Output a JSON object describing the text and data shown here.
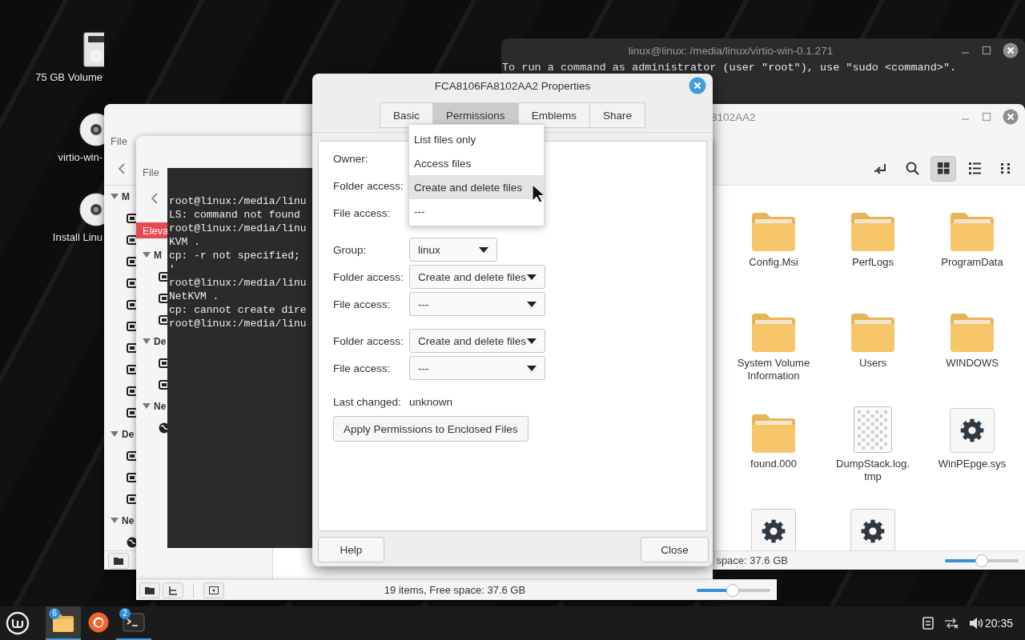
{
  "desktop_icons": [
    {
      "label": "75 GB Volume",
      "kind": "drive"
    },
    {
      "label": "virtio-win-",
      "kind": "disc"
    },
    {
      "label": "Install Linu",
      "kind": "disc"
    }
  ],
  "terminal_back": {
    "title": "linux@linux: /media/linux/virtio-win-0.1.271",
    "lines": [
      "To run a command as administrator (user \"root\"), use \"sudo <command>\"."
    ]
  },
  "file_manager_back": {
    "title": "8102AA2",
    "menu_label": "File",
    "sidebar": [
      {
        "kind": "header",
        "label": "M"
      },
      {
        "kind": "place"
      },
      {
        "kind": "place"
      },
      {
        "kind": "place"
      },
      {
        "kind": "place"
      },
      {
        "kind": "place"
      },
      {
        "kind": "place"
      },
      {
        "kind": "place"
      },
      {
        "kind": "place"
      },
      {
        "kind": "place"
      },
      {
        "kind": "place"
      },
      {
        "kind": "header",
        "label": "De"
      },
      {
        "kind": "place"
      },
      {
        "kind": "place"
      },
      {
        "kind": "place"
      },
      {
        "kind": "header",
        "label": "Ne"
      },
      {
        "kind": "network"
      }
    ],
    "view_buttons": [
      {
        "kind": "return",
        "selected": false
      },
      {
        "kind": "search",
        "selected": false
      },
      {
        "kind": "grid",
        "selected": true
      },
      {
        "kind": "list",
        "selected": false
      },
      {
        "kind": "compact",
        "selected": false
      }
    ],
    "items": [
      {
        "name": "Config.Msi",
        "kind": "folder"
      },
      {
        "name": "PerfLogs",
        "kind": "folder"
      },
      {
        "name": "ProgramData",
        "kind": "folder"
      },
      {
        "name": "System Volume Information",
        "kind": "folder"
      },
      {
        "name": "Users",
        "kind": "folder"
      },
      {
        "name": "WINDOWS",
        "kind": "folder"
      },
      {
        "name": "found.000",
        "kind": "folder"
      },
      {
        "name": "DumpStack.log.tmp",
        "kind": "text"
      },
      {
        "name": "WinPEpge.sys",
        "kind": "system"
      },
      {
        "kind": "system"
      },
      {
        "kind": "system"
      }
    ],
    "status": "space: 37.6 GB",
    "zoom_slider": {
      "level": 0.5
    }
  },
  "file_manager_front": {
    "menu_label": "File",
    "banner": "Eleva",
    "sidebar": [
      {
        "kind": "header",
        "label": "M"
      },
      {
        "kind": "place"
      },
      {
        "kind": "place"
      },
      {
        "kind": "place"
      },
      {
        "kind": "header",
        "label": "De"
      },
      {
        "kind": "place"
      },
      {
        "kind": "place"
      },
      {
        "kind": "header",
        "label": "Ne"
      },
      {
        "kind": "network"
      }
    ],
    "status": "19 items, Free space: 37.6 GB",
    "zoom_slider": {
      "level": 0.49
    }
  },
  "terminal_front": {
    "lines": [
      "root@linux:/media/linu",
      "LS: command not found",
      "root@linux:/media/linu",
      "KVM .",
      "cp: -r not specified;",
      "'",
      "root@linux:/media/linu",
      "NetKVM .",
      "cp: cannot create dire",
      "root@linux:/media/linu"
    ]
  },
  "properties_dialog": {
    "title": "FCA8106FA8102AA2 Properties",
    "tabs": [
      {
        "label": "Basic",
        "selected": false
      },
      {
        "label": "Permissions",
        "selected": true
      },
      {
        "label": "Emblems",
        "selected": false
      },
      {
        "label": "Share",
        "selected": false
      }
    ],
    "owner_rows": [
      {
        "label": "Owner:"
      },
      {
        "label": "Folder access:"
      },
      {
        "label": "File access:"
      }
    ],
    "group_rows": [
      {
        "label": "Group:",
        "value": "linux"
      },
      {
        "label": "Folder access:",
        "value": "Create and delete files"
      },
      {
        "label": "File access:",
        "value": "---"
      }
    ],
    "other_rows": [
      {
        "label": "Folder access:",
        "value": "Create and delete files"
      },
      {
        "label": "File access:",
        "value": "---"
      }
    ],
    "last_changed": {
      "label": "Last changed:",
      "value": "unknown"
    },
    "apply_button": "Apply Permissions to Enclosed Files",
    "help_button": "Help",
    "close_button": "Close",
    "dropdown_menu": [
      {
        "label": "List files only",
        "selected": false
      },
      {
        "label": "Access files",
        "selected": false
      },
      {
        "label": "Create and delete files",
        "selected": true
      },
      {
        "label": "---",
        "selected": false
      }
    ]
  },
  "taskbar": {
    "launchers": [
      {
        "kind": "files",
        "badge": "6",
        "selected": true,
        "running": true
      },
      {
        "kind": "browser",
        "selected": false,
        "running": false
      },
      {
        "kind": "terminal",
        "badge": "2",
        "selected": false,
        "running": true
      }
    ],
    "tray": [
      {
        "kind": "notes"
      },
      {
        "kind": "network"
      },
      {
        "kind": "volume"
      }
    ],
    "clock": "20:35"
  }
}
